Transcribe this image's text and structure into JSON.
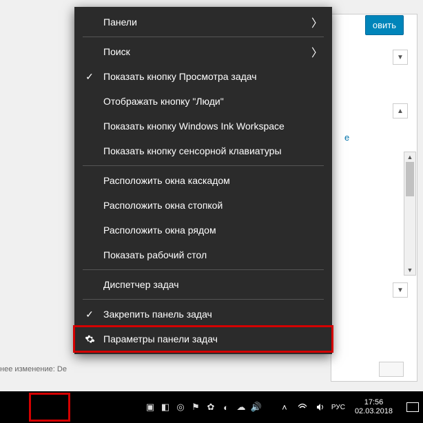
{
  "background": {
    "blue_button": "овить",
    "link_text": "e",
    "bottom_text": "нее изменение: Dе"
  },
  "context_menu": {
    "groups": [
      [
        {
          "label": "Панели",
          "submenu": true
        }
      ],
      [
        {
          "label": "Поиск",
          "submenu": true
        },
        {
          "label": "Показать кнопку Просмотра задач",
          "checked": true
        },
        {
          "label": "Отображать кнопку \"Люди\""
        },
        {
          "label": "Показать кнопку Windows Ink Workspace"
        },
        {
          "label": "Показать кнопку сенсорной клавиатуры"
        }
      ],
      [
        {
          "label": "Расположить окна каскадом"
        },
        {
          "label": "Расположить окна стопкой"
        },
        {
          "label": "Расположить окна рядом"
        },
        {
          "label": "Показать рабочий стол"
        }
      ],
      [
        {
          "label": "Диспетчер задач"
        }
      ],
      [
        {
          "label": "Закрепить панель задач",
          "checked": true
        },
        {
          "label": "Параметры панели задач",
          "icon": "gear",
          "highlighted": true
        }
      ]
    ]
  },
  "taskbar": {
    "clock_time": "17:56",
    "clock_date": "02.03.2018"
  }
}
